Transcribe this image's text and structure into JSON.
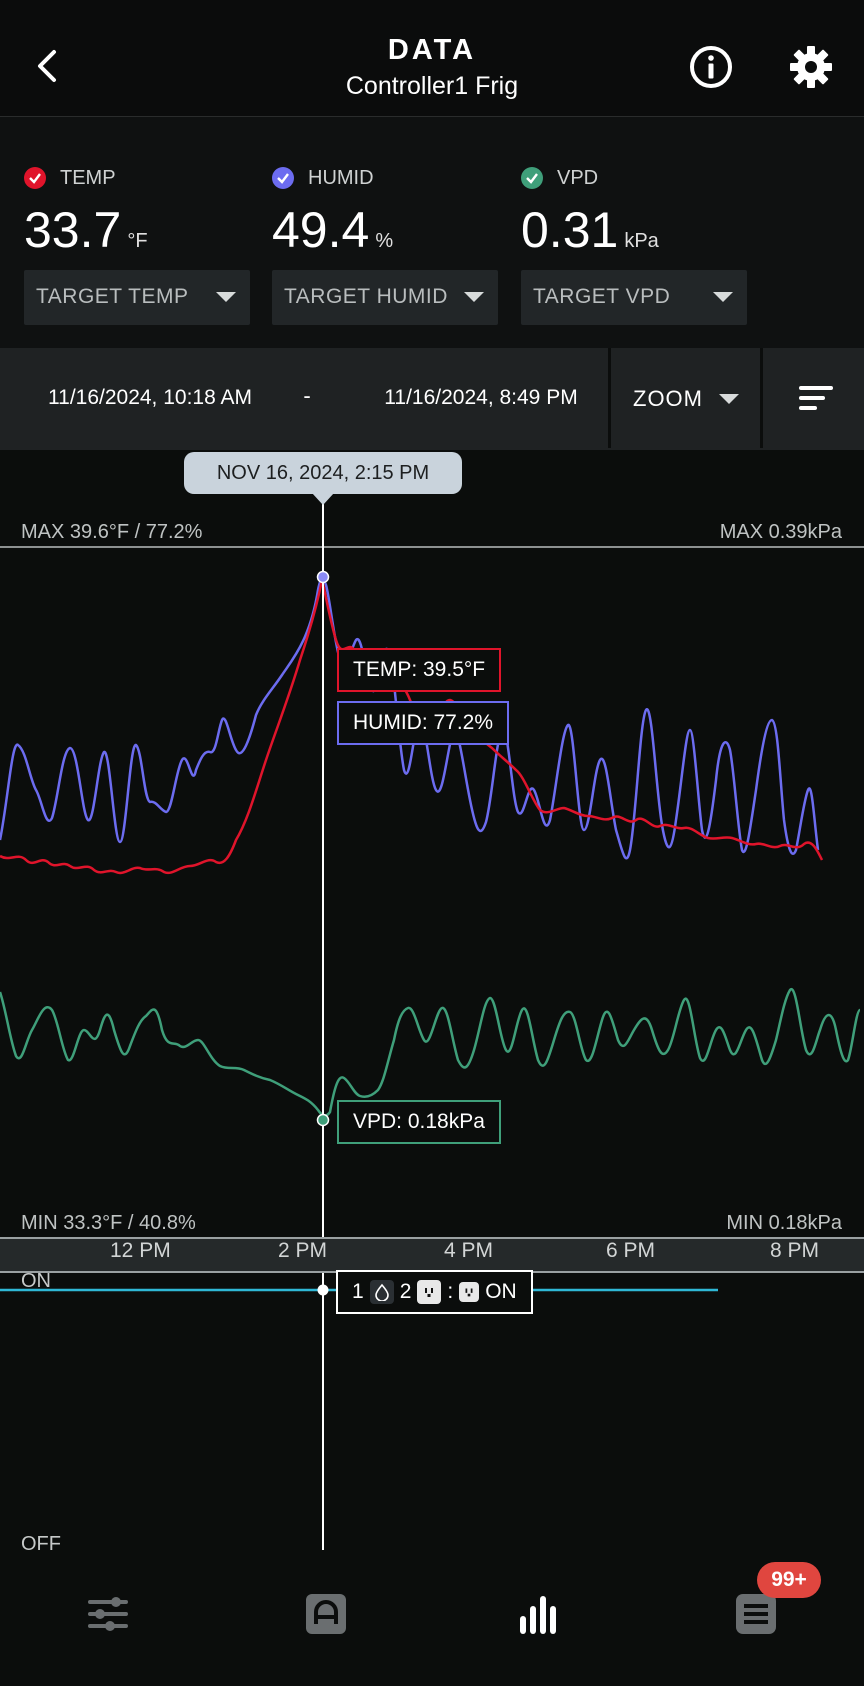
{
  "header": {
    "title": "DATA",
    "subtitle": "Controller1 Frig"
  },
  "readings": [
    {
      "label": "TEMP",
      "value": "33.7",
      "unit": "°F",
      "check_color": "#e0142b",
      "target": "TARGET TEMP"
    },
    {
      "label": "HUMID",
      "value": "49.4",
      "unit": "%",
      "check_color": "#6c6cf0",
      "target": "TARGET HUMID"
    },
    {
      "label": "VPD",
      "value": "0.31",
      "unit": "kPa",
      "check_color": "#3f9f7a",
      "target": "TARGET VPD"
    }
  ],
  "datebar": {
    "start": "11/16/2024, 10:18 AM",
    "dash": "-",
    "end": "11/16/2024, 8:49 PM",
    "zoom": "ZOOM"
  },
  "chart": {
    "cursor_time": "NOV 16, 2024, 2:15 PM",
    "max_left": "MAX 39.6°F / 77.2%",
    "max_right": "MAX 0.39kPa",
    "min_left": "MIN 33.3°F / 40.8%",
    "min_right": "MIN 0.18kPa",
    "tip_temp": "TEMP: 39.5°F",
    "tip_humid": "HUMID: 77.2%",
    "tip_vpd": "VPD: 0.18kPa",
    "on_label": "ON",
    "off_label": "OFF",
    "device_tip": {
      "num1": "1",
      "num2": "2",
      "sep": ":",
      "state": "ON"
    }
  },
  "chart_data": {
    "type": "line",
    "x_ticks": [
      "12 PM",
      "2 PM",
      "4 PM",
      "6 PM",
      "8 PM"
    ],
    "series": [
      {
        "name": "TEMP",
        "color": "#e0142b",
        "unit": "°F"
      },
      {
        "name": "HUMID",
        "color": "#6c6cf0",
        "unit": "%"
      },
      {
        "name": "VPD",
        "color": "#3f9f7a",
        "unit": "kPa"
      }
    ],
    "temp_range": [
      33.3,
      39.6
    ],
    "humid_range": [
      40.8,
      77.2
    ],
    "vpd_range": [
      0.18,
      0.39
    ],
    "cursor": {
      "time": "2:15 PM",
      "temp": 39.5,
      "humid": 77.2,
      "vpd": 0.18,
      "device": "ON"
    }
  },
  "nav": {
    "badge": "99+"
  },
  "colors": {
    "temp": "#e0142b",
    "humid": "#6c6cf0",
    "vpd": "#3f9f7a",
    "device_line": "#2fb7d6"
  }
}
